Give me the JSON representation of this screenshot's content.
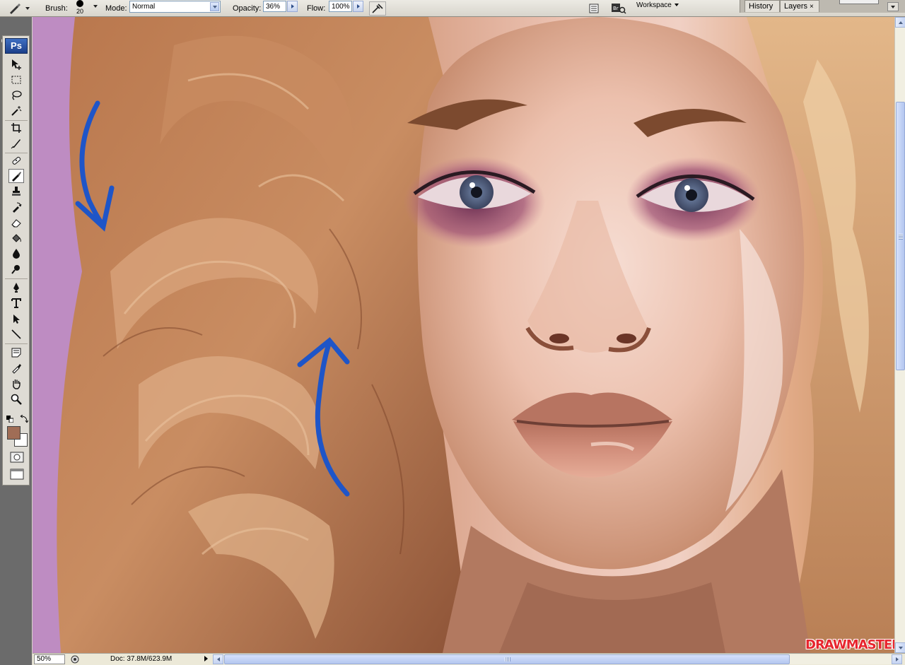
{
  "options_bar": {
    "brush_label": "Brush:",
    "brush_size": "20",
    "mode_label": "Mode:",
    "mode_value": "Normal",
    "opacity_label": "Opacity:",
    "opacity_value": "36%",
    "flow_label": "Flow:",
    "flow_value": "100%",
    "workspace_label": "Workspace"
  },
  "panels": {
    "history_tab": "History",
    "layers_tab": "Layers",
    "layers_close": "×"
  },
  "toolbox": {
    "logo": "Ps",
    "foreground_color": "#a06d56",
    "background_color": "#ffffff",
    "active_tool": "brush-tool",
    "tools": [
      "move-tool",
      "marquee-tool",
      "lasso-tool",
      "magic-wand-tool",
      "crop-tool",
      "slice-tool",
      "healing-brush-tool",
      "brush-tool",
      "clone-stamp-tool",
      "history-brush-tool",
      "eraser-tool",
      "paint-bucket-tool",
      "blur-tool",
      "dodge-tool",
      "pen-tool",
      "type-tool",
      "path-selection-tool",
      "line-tool",
      "notes-tool",
      "eyedropper-tool",
      "hand-tool",
      "zoom-tool"
    ]
  },
  "status_bar": {
    "zoom": "50%",
    "doc_info": "Doc: 37.8M/623.9M"
  },
  "canvas": {
    "annotation_color": "#1e55c8",
    "watermark": "DRAWMASTER.RU"
  }
}
